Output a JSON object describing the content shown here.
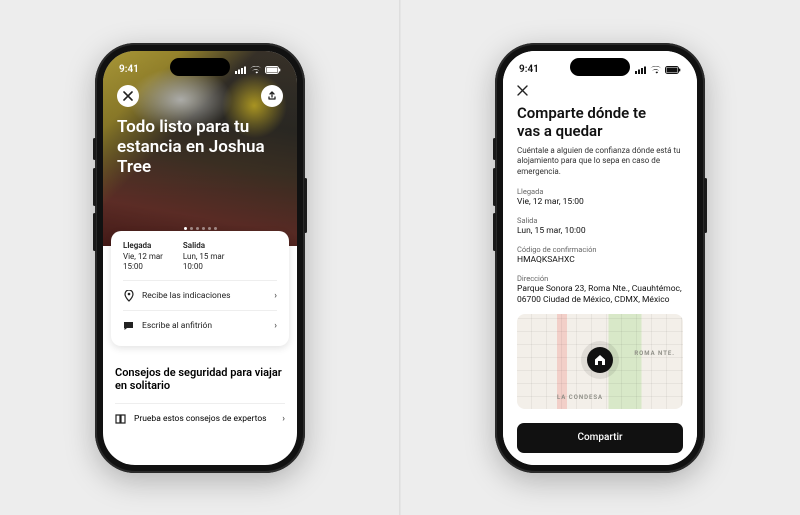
{
  "status_time": "9:41",
  "left": {
    "hero_title": "Todo listo para tu estancia en Joshua Tree",
    "checkin_label": "Llegada",
    "checkin_value": "Vie, 12 mar\n15:00",
    "checkout_label": "Salida",
    "checkout_value": "Lun, 15 mar\n10:00",
    "row_directions": "Recibe las indicaciones",
    "row_message_host": "Escribe al anfitrión",
    "safety_title": "Consejos de seguridad para viajar en solitario",
    "safety_row": "Prueba estos consejos de expertos"
  },
  "right": {
    "title": "Comparte dónde te vas a quedar",
    "subtitle": "Cuéntale a alguien de confianza dónde está tu alojamiento para que lo sepa en caso de emergencia.",
    "checkin_label": "Llegada",
    "checkin_value": "Vie, 12 mar, 15:00",
    "checkout_label": "Salida",
    "checkout_value": "Lun, 15 mar, 10:00",
    "conf_label": "Código de confirmación",
    "conf_value": "HMAQKSAHXC",
    "addr_label": "Dirección",
    "addr_value": "Parque Sonora 23, Roma Nte., Cuauhtémoc, 06700 Ciudad de México, CDMX, México",
    "map_label_a": "ROMA NTE.",
    "map_label_b": "LA CONDESA",
    "share_button": "Compartir"
  }
}
